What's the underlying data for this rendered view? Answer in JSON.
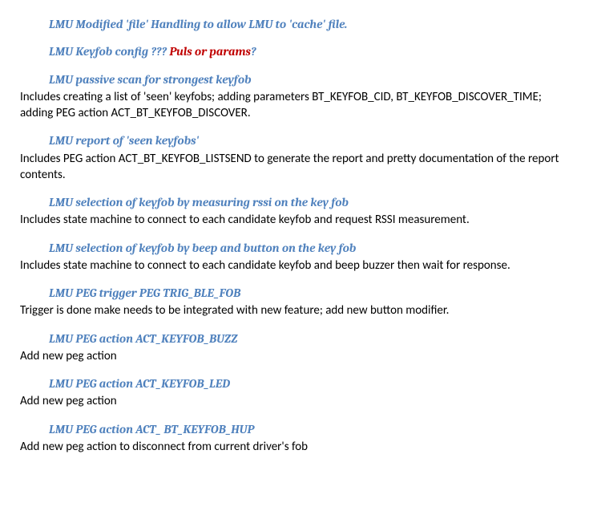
{
  "sections": {
    "s1": {
      "title": "LMU Modified 'file' Handling to allow LMU to 'cache' file."
    },
    "s2": {
      "title_pre": "LMU Keyfob config ??? ",
      "title_red": "Puls or params",
      "title_post": "?"
    },
    "s3": {
      "title": "LMU passive scan for strongest keyfob",
      "body": "Includes creating a list of 'seen' keyfobs; adding parameters BT_KEYFOB_CID, BT_KEYFOB_DISCOVER_TIME; adding PEG action ACT_BT_KEYFOB_DISCOVER."
    },
    "s4": {
      "title": "LMU report of 'seen keyfobs'",
      "body": "Includes PEG action ACT_BT_KEYFOB_LISTSEND  to generate the report and pretty documentation of the report contents."
    },
    "s5": {
      "title": "LMU selection of keyfob by measuring rssi on the key fob",
      "body": "Includes state machine to connect to each candidate keyfob and request RSSI measurement."
    },
    "s6": {
      "title": "LMU selection of keyfob by beep and button on the key fob",
      "body": "Includes state machine to connect to each candidate keyfob and beep buzzer then wait for response."
    },
    "s7": {
      "title": "LMU PEG trigger PEG TRIG_BLE_FOB",
      "body": "Trigger is done make needs to be integrated with new feature; add new button modifier."
    },
    "s8": {
      "title": "LMU PEG action ACT_KEYFOB_BUZZ",
      "body": "Add new peg action"
    },
    "s9": {
      "title": "LMU PEG action ACT_KEYFOB_LED",
      "body": "Add new peg action"
    },
    "s10": {
      "title": "LMU PEG action ACT_ BT_KEYFOB_HUP",
      "body": "Add new peg action to disconnect from current driver's fob"
    }
  }
}
